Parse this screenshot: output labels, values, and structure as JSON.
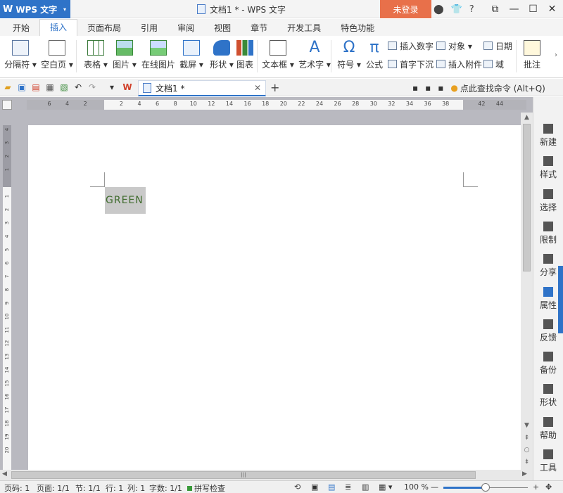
{
  "titlebar": {
    "app_name": "WPS 文字",
    "doc_title": "文档1 * - WPS 文字",
    "login": "未登录",
    "help": "?"
  },
  "menu_tabs": [
    "开始",
    "插入",
    "页面布局",
    "引用",
    "审阅",
    "视图",
    "章节",
    "开发工具",
    "特色功能"
  ],
  "active_tab": "插入",
  "ribbon": {
    "big": [
      {
        "label": "分隔符 ▾",
        "icon": "page-break-icon"
      },
      {
        "label": "空白页 ▾",
        "icon": "blank-page-icon"
      },
      {
        "label": "表格 ▾",
        "icon": "table-icon"
      },
      {
        "label": "图片 ▾",
        "icon": "picture-icon"
      },
      {
        "label": "在线图片",
        "icon": "online-picture-icon"
      },
      {
        "label": "截屏 ▾",
        "icon": "screenshot-icon"
      },
      {
        "label": "形状 ▾",
        "icon": "shapes-icon"
      },
      {
        "label": "图表",
        "icon": "chart-icon"
      },
      {
        "label": "文本框 ▾",
        "icon": "textbox-icon"
      },
      {
        "label": "艺术字 ▾",
        "icon": "wordart-icon"
      },
      {
        "label": "符号 ▾",
        "icon": "omega-icon"
      },
      {
        "label": "公式",
        "icon": "pi-icon"
      }
    ],
    "small": {
      "insert_number": "插入数字",
      "object": "对象 ▾",
      "date": "日期",
      "drop_cap": "首字下沉",
      "attachment": "插入附件",
      "field": "域"
    },
    "annotate": "批注"
  },
  "document_tab": "文档1 *",
  "command_search": "点此查找命令 (Alt+Q)",
  "hruler_ticks": [
    "6",
    "4",
    "2",
    "",
    "2",
    "4",
    "6",
    "8",
    "10",
    "12",
    "14",
    "16",
    "18",
    "20",
    "22",
    "24",
    "26",
    "28",
    "30",
    "32",
    "34",
    "36",
    "38",
    "",
    "42",
    "44"
  ],
  "vruler_ticks": [
    "4",
    "3",
    "2",
    "1",
    "",
    "1",
    "2",
    "3",
    "4",
    "5",
    "6",
    "7",
    "8",
    "9",
    "10",
    "11",
    "12",
    "13",
    "14",
    "15",
    "16",
    "17",
    "18",
    "19",
    "20"
  ],
  "document": {
    "cell_text": "GREEN"
  },
  "sidebar": [
    {
      "label": "新建",
      "icon": "new-doc-icon"
    },
    {
      "label": "样式",
      "icon": "style-icon"
    },
    {
      "label": "选择",
      "icon": "select-icon"
    },
    {
      "label": "限制",
      "icon": "restrict-icon"
    },
    {
      "label": "分享",
      "icon": "share-icon"
    },
    {
      "label": "属性",
      "icon": "properties-icon"
    },
    {
      "label": "反馈",
      "icon": "feedback-icon"
    },
    {
      "label": "备份",
      "icon": "backup-icon"
    },
    {
      "label": "形状",
      "icon": "shape-icon"
    },
    {
      "label": "帮助",
      "icon": "help-icon"
    },
    {
      "label": "工具",
      "icon": "tools-icon"
    }
  ],
  "statusbar": {
    "page_code": "页码: 1",
    "pages": "页面: 1/1",
    "section": "节: 1/1",
    "row": "行: 1",
    "col": "列: 1",
    "words": "字数: 1/1",
    "spellcheck": "拼写检查",
    "zoom": "100 %",
    "zoom_level": 0.5
  },
  "colors": {
    "accent": "#2f73c8",
    "login": "#e8704a",
    "cell_bg": "#c9c9c9",
    "cell_text": "#3f6b2d"
  }
}
